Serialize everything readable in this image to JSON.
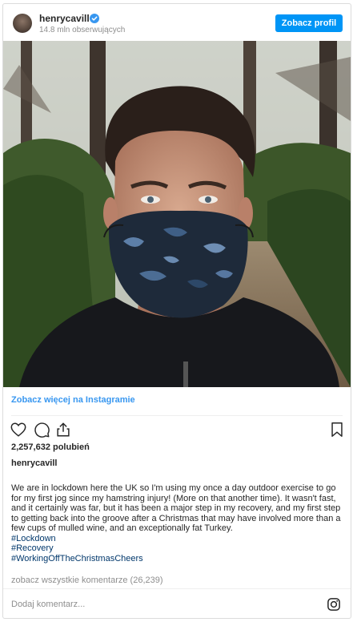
{
  "header": {
    "username": "henrycavill",
    "followers": "14.8 mln obserwujących",
    "profile_button": "Zobacz profil"
  },
  "post": {
    "image_alt": "Selfie in camouflage face mask on forest path",
    "see_more": "Zobacz więcej na Instagramie",
    "likes": "2,257,632 polubień",
    "caption_user": "henrycavill",
    "caption_text": "We are in lockdown here the UK so I'm using my once a day outdoor exercise to go for my first jog since my hamstring injury! (More on that another time). It wasn't fast, and it certainly was far, but it has been a major step in my recovery, and my first step to getting back into the groove after a Christmas that may have involved more than a few cups of mulled wine, and an exceptionally fat Turkey.",
    "hashtags": [
      "#Lockdown",
      "#Recovery",
      "#WorkingOffTheChristmasCheers"
    ],
    "comments_link": "zobacz wszystkie komentarze (26,239)",
    "comment_placeholder": "Dodaj komentarz..."
  },
  "icons": {
    "like": "heart-icon",
    "comment": "comment-icon",
    "share": "share-icon",
    "save": "bookmark-icon",
    "brand": "instagram-icon",
    "verified": "verified-badge-icon"
  },
  "colors": {
    "accent": "#0095f6",
    "link": "#3897f0",
    "hashtag": "#00376b",
    "muted": "#8e8e8e",
    "border": "#dbdbdb"
  }
}
